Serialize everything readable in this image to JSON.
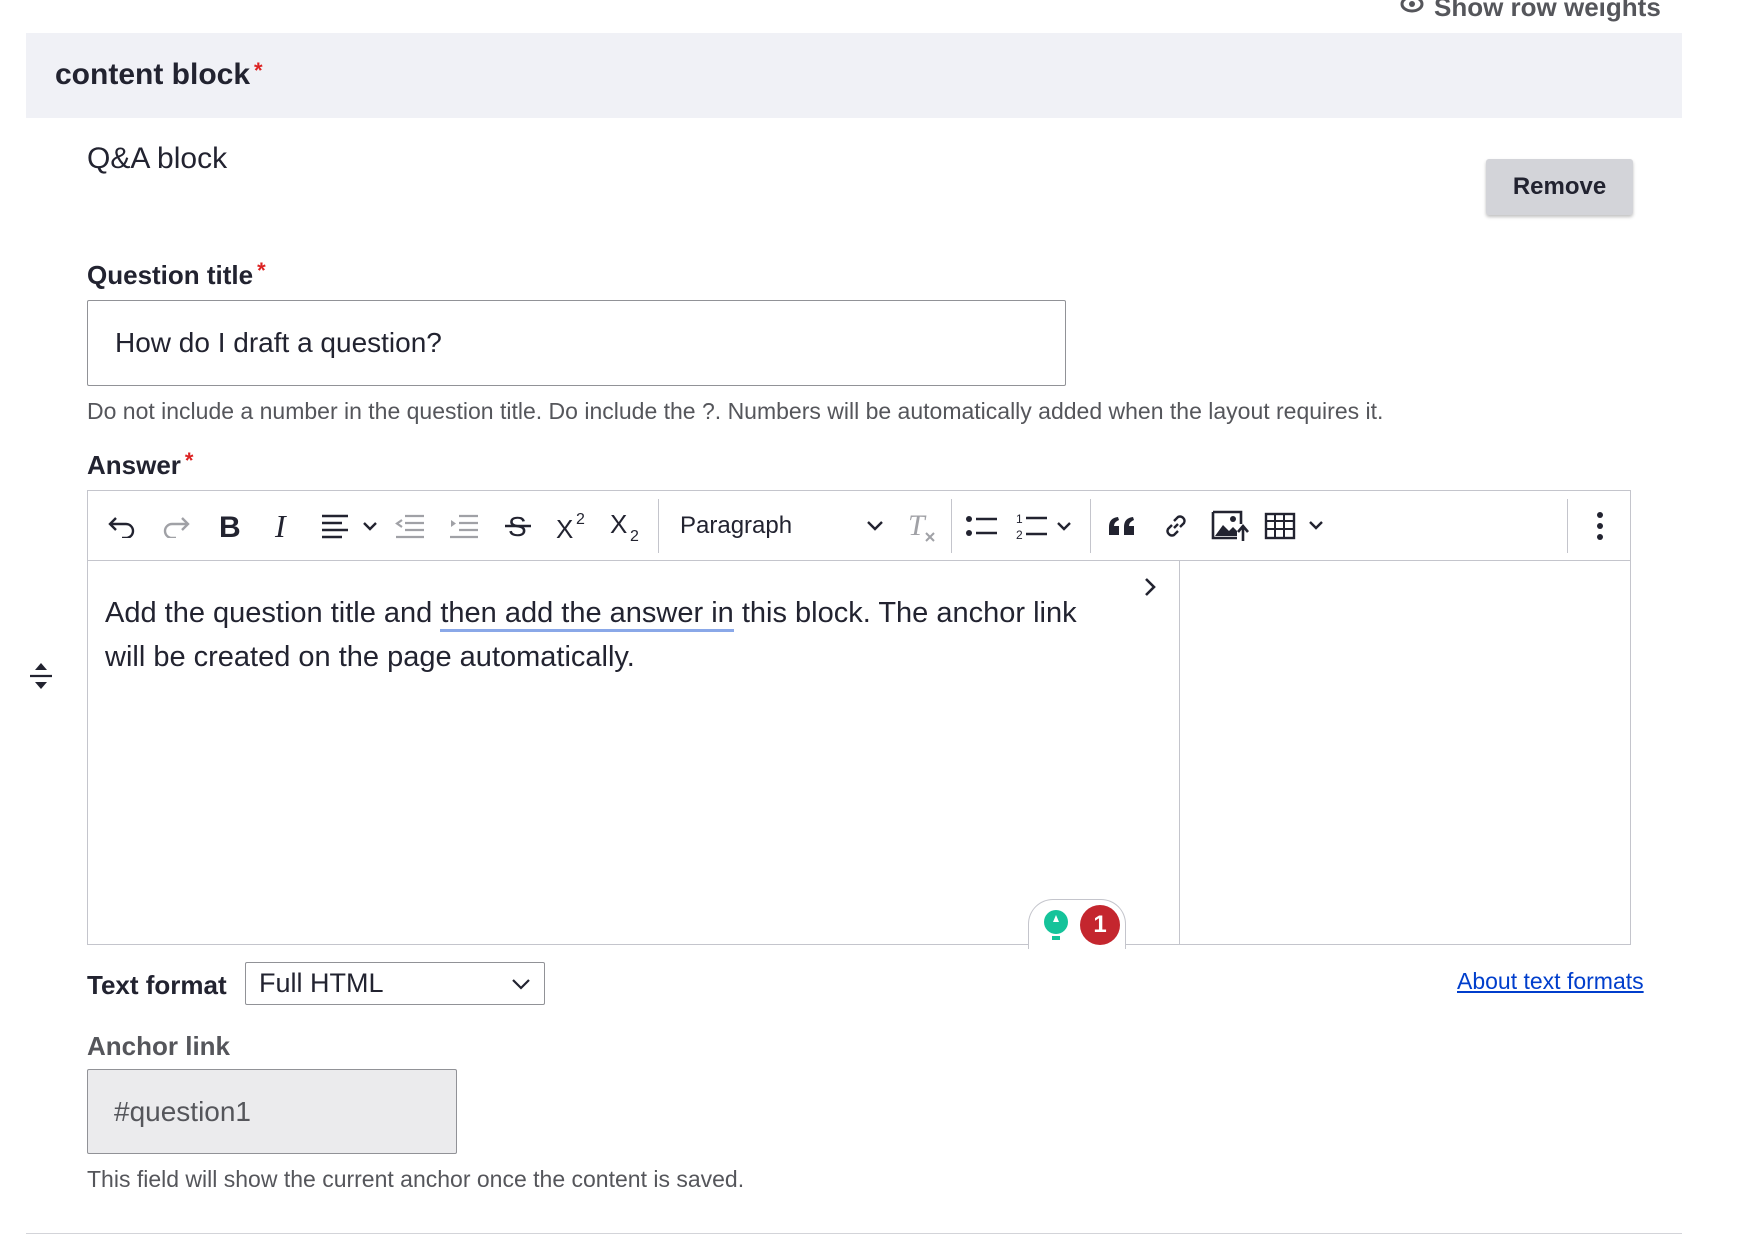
{
  "top_link": {
    "label": "Show row weights",
    "icon": "eye-icon"
  },
  "header": {
    "title": "content block",
    "required_mark": "*"
  },
  "block": {
    "name": "Q&A block",
    "remove_label": "Remove"
  },
  "question": {
    "label": "Question title",
    "required_mark": "*",
    "value": "How do I draft a question?",
    "help": "Do not include a number in the question title. Do include the ?. Numbers will be automatically added when the layout requires it."
  },
  "answer": {
    "label": "Answer",
    "required_mark": "*",
    "paragraph_style": "Paragraph",
    "content_before": "Add the question title and ",
    "content_underlined": "then add the answer in",
    "content_after": " this block. The anchor link will be created on the page automatically.",
    "grammarly_count": "1"
  },
  "toolbar": {
    "icons": [
      "undo-icon",
      "redo-icon",
      "bold-icon",
      "italic-icon",
      "align-icon",
      "outdent-icon",
      "indent-icon",
      "strikethrough-icon",
      "superscript-icon",
      "subscript-icon",
      "remove-format-icon",
      "bulleted-list-icon",
      "numbered-list-icon",
      "blockquote-icon",
      "link-icon",
      "insert-image-icon",
      "insert-table-icon",
      "more-options-icon"
    ]
  },
  "text_format": {
    "label": "Text format",
    "selected": "Full HTML",
    "about_link": "About text formats"
  },
  "anchor": {
    "label": "Anchor link",
    "value": "#question1",
    "help": "This field will show the current anchor once the content is saved."
  },
  "colors": {
    "accent_link": "#003ecc",
    "required": "#dc2323",
    "header_band": "#f0f1f6",
    "badge": "#c4262e",
    "grammarly_green": "#15c39a"
  }
}
